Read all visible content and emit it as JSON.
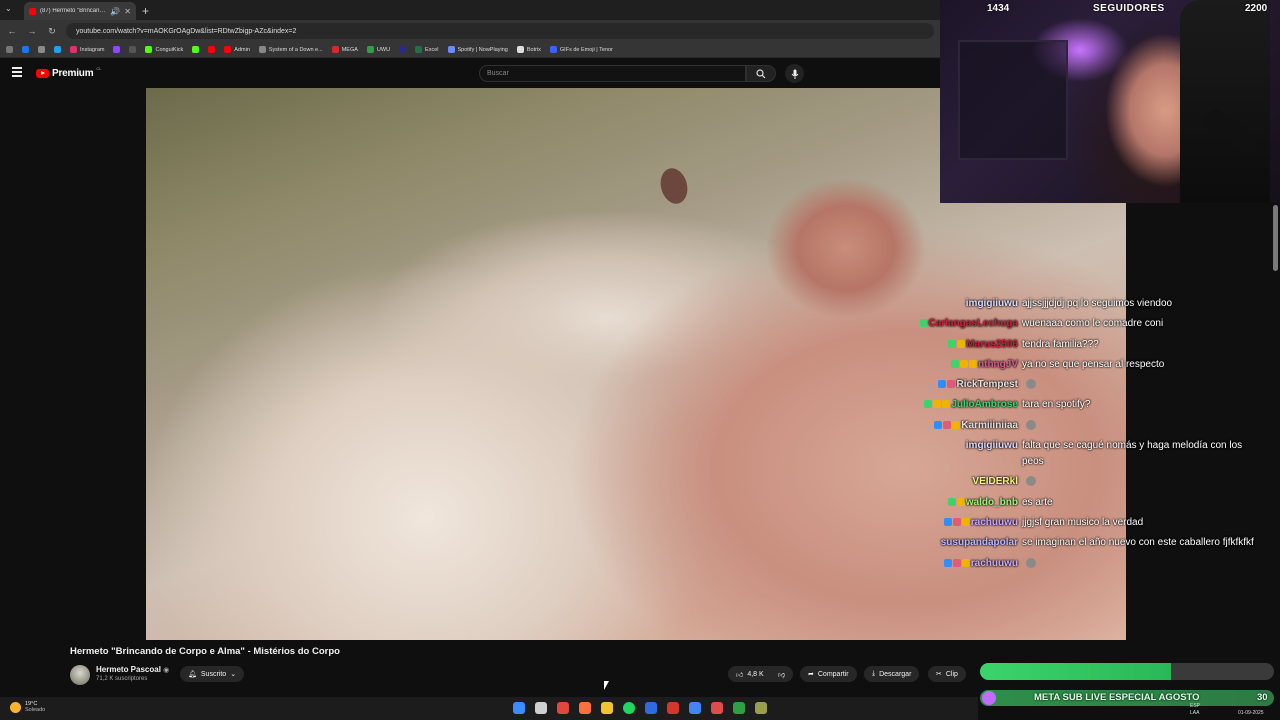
{
  "browser": {
    "tab_title": "(87) Hermeto \"Brincando de",
    "url": "youtube.com/watch?v=mAOKGrOAgDw&list=RDtwZbigp-AZc&index=2",
    "bookmarks": [
      {
        "label": "",
        "color": "#1877f2"
      },
      {
        "label": "",
        "color": "#8a8a8a"
      },
      {
        "label": "",
        "color": "#1da1f2"
      },
      {
        "label": "Instagram",
        "color": "#e1306c"
      },
      {
        "label": "",
        "color": "#9146ff"
      },
      {
        "label": "",
        "color": "#555555"
      },
      {
        "label": "ConguiKick",
        "color": "#53fc18"
      },
      {
        "label": "",
        "color": "#53fc18"
      },
      {
        "label": "",
        "color": "#ff0000"
      },
      {
        "label": "Admin",
        "color": "#ff0000"
      },
      {
        "label": "System of a Down e...",
        "color": "#888888"
      },
      {
        "label": "MEGA",
        "color": "#d9272e"
      },
      {
        "label": "UWU",
        "color": "#2ea043"
      },
      {
        "label": "",
        "color": "#2a2a8a"
      },
      {
        "label": "Excel",
        "color": "#1f7244"
      },
      {
        "label": "Spotify | NowPlaying",
        "color": "#6a8cff"
      },
      {
        "label": "Botrix",
        "color": "#dddddd"
      },
      {
        "label": "GIFs de Emoji | Tenor",
        "color": "#3a62ff"
      }
    ]
  },
  "youtube": {
    "logo": "Premium",
    "logo_region": "CL",
    "search_placeholder": "Buscar",
    "video_title": "Hermeto \"Brincando de Corpo e Alma\" - Mistérios do Corpo",
    "channel_name": "Hermeto Pascoal",
    "subscribers": "71,2 K suscriptores",
    "subscribe_label": "Suscrito",
    "likes": "4,8 K",
    "share_label": "Compartir",
    "download_label": "Descargar",
    "clip_label": "Clip"
  },
  "chat": {
    "messages": [
      {
        "user": "imgigiiuwu",
        "color": "#d8d8ff",
        "text": "ajjssjjjdjdj pq lo seguimos viendoo",
        "badges": [],
        "emote": false
      },
      {
        "user": "CarlangasLechuga",
        "color": "#d1193a",
        "text": "wuenaaa como le comadre coni",
        "badges": [
          "#3bd46a"
        ],
        "emote": false
      },
      {
        "user": "Marus2506",
        "color": "#c81e3a",
        "text": "tendra familia???",
        "badges": [
          "#3bd46a",
          "#f0b400"
        ],
        "emote": false
      },
      {
        "user": "nthngJV",
        "color": "#d35a8a",
        "text": "ya no se que pensar al respecto",
        "badges": [
          "#3bd46a",
          "#f0b400",
          "#f0b400"
        ],
        "emote": false
      },
      {
        "user": "RickTempest",
        "color": "#e0e0e0",
        "text": "",
        "badges": [
          "#2d8fff",
          "#e05a7a"
        ],
        "emote": true
      },
      {
        "user": "JulioAmbrose",
        "color": "#3bd46a",
        "text": "tara en spotify?",
        "badges": [
          "#3bd46a",
          "#f0b400",
          "#f0b400"
        ],
        "emote": false
      },
      {
        "user": "Karmiiiniiaa",
        "color": "#e0e0e0",
        "text": "",
        "badges": [
          "#2d8fff",
          "#e05a7a",
          "#f0b400"
        ],
        "emote": true
      },
      {
        "user": "imgigiiuwu",
        "color": "#d8d8ff",
        "text": "falta que se cagué nomás y haga melodía con los peos",
        "badges": [],
        "emote": false
      },
      {
        "user": "VEIDERkl",
        "color": "#f2f27a",
        "text": "",
        "badges": [],
        "emote": true
      },
      {
        "user": "waldo_bnb",
        "color": "#9cf07a",
        "text": "es arte",
        "badges": [
          "#3bd46a",
          "#f0b400"
        ],
        "emote": false
      },
      {
        "user": "rachuuwu",
        "color": "#c8a6ff",
        "text": "jjgjsf gran musico la verdad",
        "badges": [
          "#2d8fff",
          "#e05a7a",
          "#f0b400"
        ],
        "emote": false
      },
      {
        "user": "susupandapolar",
        "color": "#b6b6ff",
        "text": "se imaginan el año nuevo con este caballero fjfkfkfkf",
        "badges": [],
        "emote": false
      },
      {
        "user": "rachuuwu",
        "color": "#c8a6ff",
        "text": "",
        "badges": [
          "#2d8fff",
          "#e05a7a",
          "#f0b400"
        ],
        "emote": true
      }
    ]
  },
  "goals": {
    "followers_current": "1434",
    "followers_label": "SEGUIDORES",
    "followers_target": "2200",
    "followers_fraction": 0.65,
    "sub_goal_label": "META SUB LIVE ESPECIAL AGOSTO",
    "sub_goal_value": "30"
  },
  "taskbar": {
    "temp": "19°C",
    "weather": "Soleado",
    "lang": "ESP",
    "lang2": "LAA",
    "date": "01-09-2025",
    "apps": [
      "#3a8cff",
      "#cfcfcf",
      "#e2473b",
      "#ff7139",
      "#f4c430",
      "#1ed760",
      "#2d6cdf",
      "#d4382c",
      "#4285f4",
      "#e04b4b",
      "#2ea043",
      "#9aa04a"
    ]
  }
}
